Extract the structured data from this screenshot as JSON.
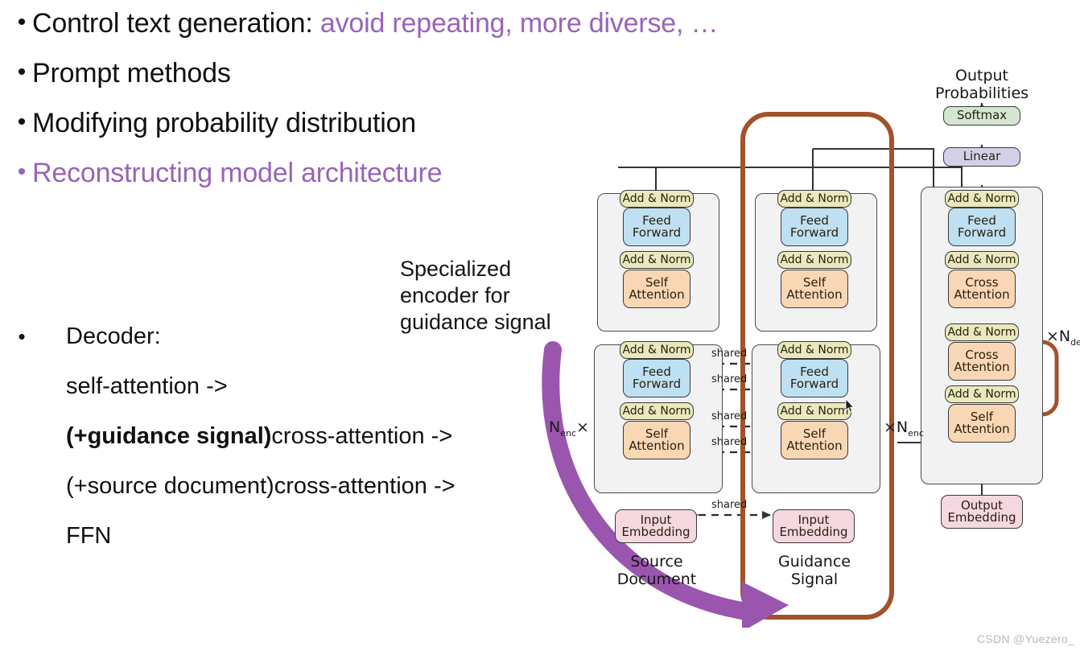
{
  "slide": {
    "bullets": [
      {
        "id": "control-text-generation",
        "prefix": "Control text generation: ",
        "accent": "avoid repeating,  more diverse, …",
        "color": "#111111",
        "accent_color": "#9a63b8"
      },
      {
        "id": "prompt-methods",
        "prefix": "Prompt methods",
        "accent": "",
        "color": "#111111"
      },
      {
        "id": "modifying-probability-distribution",
        "prefix": "Modifying probability distribution",
        "accent": "",
        "color": "#111111"
      },
      {
        "id": "reconstructing-model-architecture",
        "prefix": "Reconstructing model architecture",
        "accent": "",
        "color": "#9a63b8"
      }
    ],
    "decoder": {
      "heading": "Decoder:",
      "lines": [
        {
          "bold": "",
          "rest": "self-attention ->"
        },
        {
          "bold": "(+guidance signal)",
          "rest": "cross-attention ->"
        },
        {
          "bold": "",
          "rest": "(+source document)cross-attention ->"
        },
        {
          "bold": "",
          "rest": "FFN"
        }
      ]
    },
    "annotation": "Specialized encoder for guidance signal",
    "watermark": "CSDN @Yuezero_"
  },
  "diagram": {
    "title_output": "Output\nProbabilities",
    "blocks": {
      "softmax": "Softmax",
      "linear": "Linear",
      "add_norm": "Add & Norm",
      "feed_forward": "Feed\nForward",
      "self_attention": "Self\nAttention",
      "cross_attention": "Cross\nAttention",
      "input_embedding": "Input\nEmbedding",
      "output_embedding": "Output\nEmbedding"
    },
    "shared_label": "shared",
    "shared_count": 5,
    "repeat_labels": {
      "left_encoder": "N_enc ×",
      "mid_encoder": "× N_enc",
      "decoder": "× N_de"
    },
    "io_labels": {
      "source": "Source\nDocument",
      "guidance": "Guidance\nSignal"
    },
    "colors": {
      "add_norm": "#e9e9bd",
      "feed_forward": "#bfe0f2",
      "attention": "#f9d7b4",
      "embedding": "#f5d7df",
      "softmax": "#d4e6d2",
      "linear": "#d4d0e8",
      "stack_bg": "#f2f2f2",
      "highlight": "#a3522a",
      "arrow_purple": "#9a56ae",
      "underline_blue": "#4a4ad8"
    }
  }
}
